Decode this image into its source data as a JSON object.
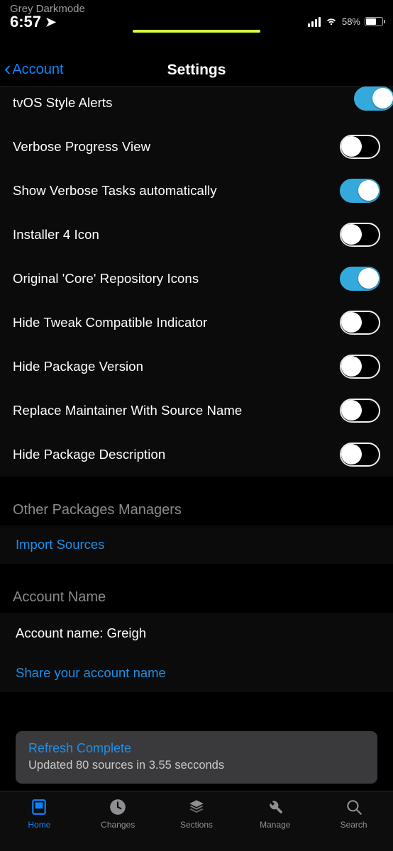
{
  "status": {
    "carrier": "Grey Darkmode",
    "time": "6:57",
    "battery_pct": "58%"
  },
  "nav": {
    "back_label": "Account",
    "title": "Settings"
  },
  "settings": [
    {
      "label": "tvOS Style Alerts",
      "on": true,
      "peek": true
    },
    {
      "label": "Verbose Progress View",
      "on": false
    },
    {
      "label": "Show Verbose Tasks automatically",
      "on": true
    },
    {
      "label": "Installer 4 Icon",
      "on": false
    },
    {
      "label": "Original 'Core' Repository Icons",
      "on": true
    },
    {
      "label": "Hide Tweak Compatible Indicator",
      "on": false
    },
    {
      "label": "Hide Package Version",
      "on": false
    },
    {
      "label": "Replace Maintainer With Source Name",
      "on": false
    },
    {
      "label": "Hide Package Description",
      "on": false
    }
  ],
  "sections": {
    "other_pm_header": "Other Packages Managers",
    "import_sources": "Import Sources",
    "account_header": "Account Name",
    "account_name_row": "Account name: Greigh",
    "share_account": "Share your account name"
  },
  "toast": {
    "title": "Refresh Complete",
    "body": "Updated 80 sources in 3.55 secconds"
  },
  "tabs": [
    {
      "id": "home",
      "label": "Home",
      "active": true
    },
    {
      "id": "changes",
      "label": "Changes",
      "active": false
    },
    {
      "id": "sections",
      "label": "Sections",
      "active": false
    },
    {
      "id": "manage",
      "label": "Manage",
      "active": false
    },
    {
      "id": "search",
      "label": "Search",
      "active": false
    }
  ]
}
